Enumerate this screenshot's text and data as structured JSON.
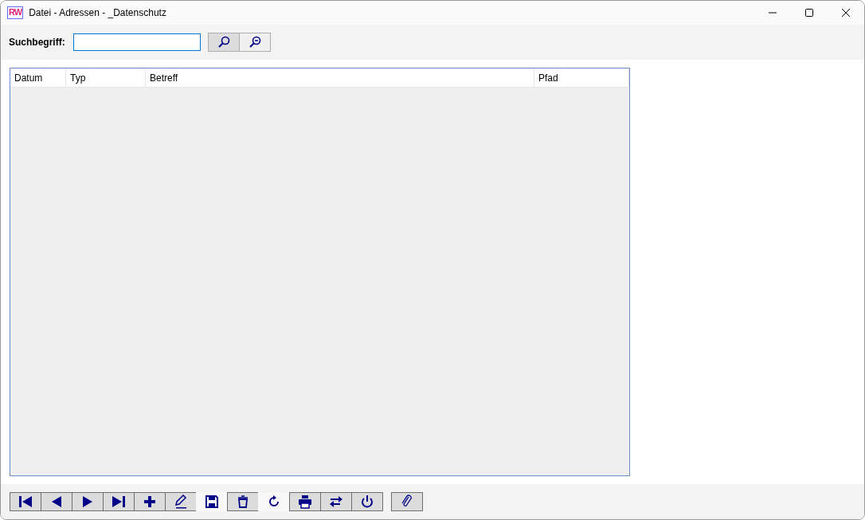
{
  "window": {
    "logo": "RW",
    "title": "Datei - Adressen - _Datenschutz"
  },
  "search": {
    "label": "Suchbegriff:",
    "buttons": [
      {
        "kind": "search",
        "pressed": true
      },
      {
        "kind": "search-clear",
        "pressed": false
      }
    ]
  },
  "table": {
    "columns": [
      "Datum",
      "Typ",
      "Betreff",
      "Pfad"
    ]
  },
  "toolbar": [
    {
      "kind": "first",
      "framed": true
    },
    {
      "kind": "prev",
      "framed": true
    },
    {
      "kind": "next",
      "framed": true
    },
    {
      "kind": "last",
      "framed": true
    },
    {
      "kind": "add",
      "framed": true
    },
    {
      "kind": "edit",
      "framed": true
    },
    {
      "kind": "save",
      "framed": false
    },
    {
      "kind": "delete",
      "framed": true
    },
    {
      "kind": "refresh",
      "framed": false
    },
    {
      "kind": "print",
      "framed": true
    },
    {
      "kind": "swap",
      "framed": true
    },
    {
      "kind": "power",
      "framed": true
    },
    {
      "kind": "gap"
    },
    {
      "kind": "attach",
      "framed": true
    }
  ]
}
